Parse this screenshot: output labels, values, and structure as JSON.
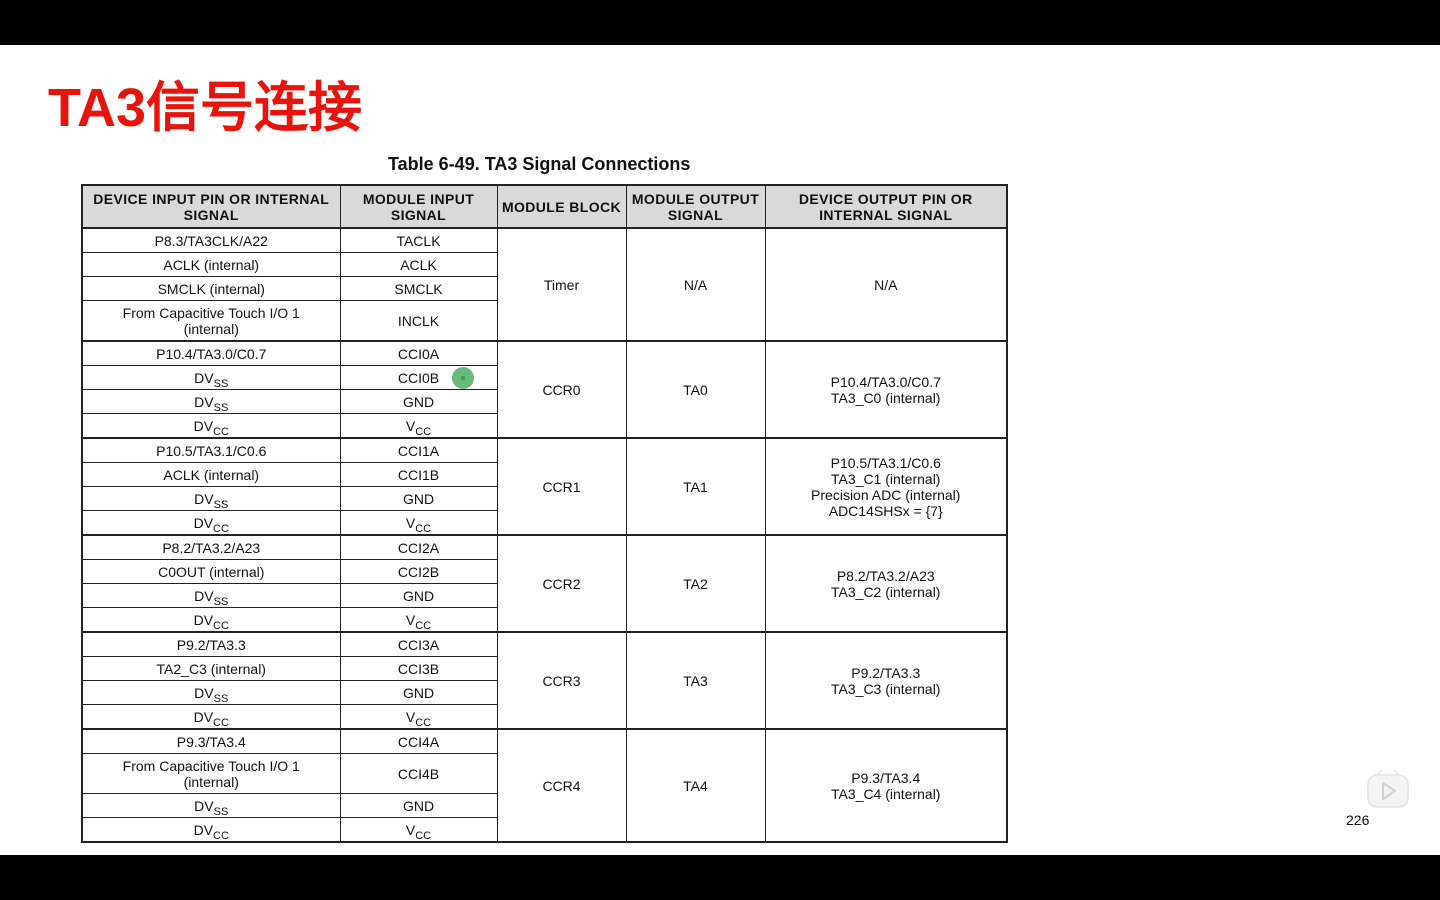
{
  "slide": {
    "title": "TA3信号连接",
    "page_number": "226"
  },
  "table": {
    "caption": "Table 6-49. TA3 Signal Connections",
    "headers": [
      "DEVICE INPUT PIN OR INTERNAL SIGNAL",
      "MODULE INPUT SIGNAL",
      "MODULE BLOCK",
      "MODULE OUTPUT SIGNAL",
      "DEVICE OUTPUT PIN OR INTERNAL SIGNAL"
    ],
    "groups": [
      {
        "block": "Timer",
        "output_signal": "N/A",
        "device_output": [
          "N/A"
        ],
        "rows": [
          {
            "pin": "P8.3/TA3CLK/A22",
            "input": "TACLK"
          },
          {
            "pin": "ACLK (internal)",
            "input": "ACLK"
          },
          {
            "pin": "SMCLK (internal)",
            "input": "SMCLK"
          },
          {
            "pin": "From Capacitive Touch I/O 1",
            "pin2": "(internal)",
            "input": "INCLK"
          }
        ]
      },
      {
        "block": "CCR0",
        "output_signal": "TA0",
        "device_output": [
          "P10.4/TA3.0/C0.7",
          "TA3_C0 (internal)"
        ],
        "rows": [
          {
            "pin": "P10.4/TA3.0/C0.7",
            "input": "CCI0A"
          },
          {
            "pin": "DV",
            "pin_sub": "SS",
            "input": "CCI0B"
          },
          {
            "pin": "DV",
            "pin_sub": "SS",
            "input": "GND"
          },
          {
            "pin": "DV",
            "pin_sub": "CC",
            "input": "V",
            "input_sub": "CC"
          }
        ]
      },
      {
        "block": "CCR1",
        "output_signal": "TA1",
        "device_output": [
          "P10.5/TA3.1/C0.6",
          "TA3_C1 (internal)",
          "Precision ADC (internal)",
          "ADC14SHSx = {7}"
        ],
        "rows": [
          {
            "pin": "P10.5/TA3.1/C0.6",
            "input": "CCI1A"
          },
          {
            "pin": "ACLK (internal)",
            "input": "CCI1B"
          },
          {
            "pin": "DV",
            "pin_sub": "SS",
            "input": "GND"
          },
          {
            "pin": "DV",
            "pin_sub": "CC",
            "input": "V",
            "input_sub": "CC"
          }
        ]
      },
      {
        "block": "CCR2",
        "output_signal": "TA2",
        "device_output": [
          "P8.2/TA3.2/A23",
          "TA3_C2 (internal)"
        ],
        "rows": [
          {
            "pin": "P8.2/TA3.2/A23",
            "input": "CCI2A"
          },
          {
            "pin": "C0OUT (internal)",
            "input": "CCI2B"
          },
          {
            "pin": "DV",
            "pin_sub": "SS",
            "input": "GND"
          },
          {
            "pin": "DV",
            "pin_sub": "CC",
            "input": "V",
            "input_sub": "CC"
          }
        ]
      },
      {
        "block": "CCR3",
        "output_signal": "TA3",
        "device_output": [
          "P9.2/TA3.3",
          "TA3_C3 (internal)"
        ],
        "rows": [
          {
            "pin": "P9.2/TA3.3",
            "input": "CCI3A"
          },
          {
            "pin": "TA2_C3 (internal)",
            "input": "CCI3B"
          },
          {
            "pin": "DV",
            "pin_sub": "SS",
            "input": "GND"
          },
          {
            "pin": "DV",
            "pin_sub": "CC",
            "input": "V",
            "input_sub": "CC"
          }
        ]
      },
      {
        "block": "CCR4",
        "output_signal": "TA4",
        "device_output": [
          "P9.3/TA3.4",
          "TA3_C4 (internal)"
        ],
        "rows": [
          {
            "pin": "P9.3/TA3.4",
            "input": "CCI4A"
          },
          {
            "pin": "From Capacitive Touch I/O 1",
            "pin2": "(internal)",
            "input": "CCI4B"
          },
          {
            "pin": "DV",
            "pin_sub": "SS",
            "input": "GND"
          },
          {
            "pin": "DV",
            "pin_sub": "CC",
            "input": "V",
            "input_sub": "CC"
          }
        ]
      }
    ]
  },
  "colors": {
    "title": "#e8140c",
    "header_bg": "#d9d9d9",
    "cursor": "#4caf65"
  },
  "icons": [
    "play-button-icon",
    "cursor-highlight-icon"
  ]
}
